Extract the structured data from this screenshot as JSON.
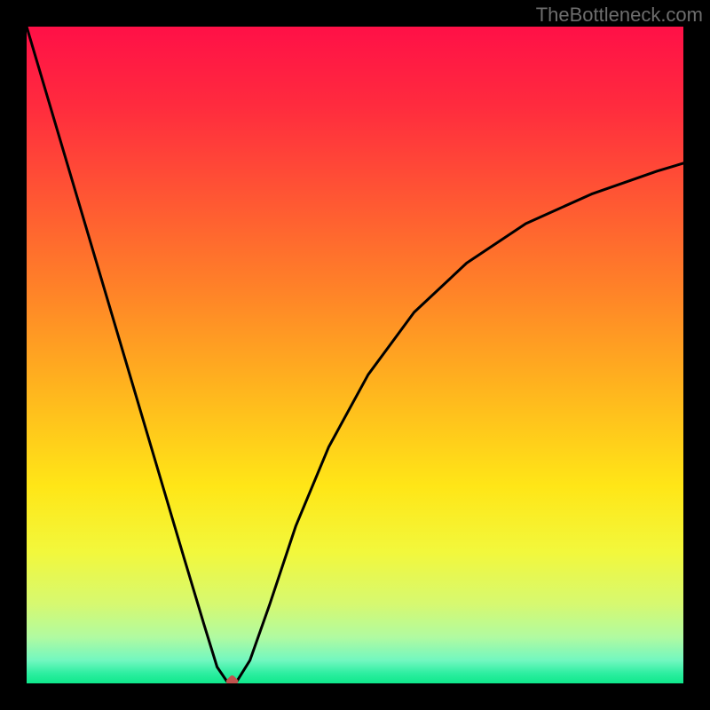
{
  "watermark": "TheBottleneck.com",
  "colors": {
    "black": "#000000",
    "curve": "#000000",
    "marker": "#c1534e",
    "gradient_stops": [
      {
        "offset": 0.0,
        "color": "#ff1047"
      },
      {
        "offset": 0.12,
        "color": "#ff2b3e"
      },
      {
        "offset": 0.25,
        "color": "#ff5334"
      },
      {
        "offset": 0.4,
        "color": "#ff8228"
      },
      {
        "offset": 0.55,
        "color": "#ffb41e"
      },
      {
        "offset": 0.7,
        "color": "#ffe617"
      },
      {
        "offset": 0.8,
        "color": "#f2f83c"
      },
      {
        "offset": 0.88,
        "color": "#d6f971"
      },
      {
        "offset": 0.93,
        "color": "#b0faa1"
      },
      {
        "offset": 0.965,
        "color": "#72f7c0"
      },
      {
        "offset": 0.985,
        "color": "#2ceea0"
      },
      {
        "offset": 1.0,
        "color": "#0fe88b"
      }
    ]
  },
  "chart_data": {
    "type": "line",
    "title": "",
    "xlabel": "",
    "ylabel": "",
    "xlim": [
      0,
      100
    ],
    "ylim": [
      0,
      100
    ],
    "grid": false,
    "legend": false,
    "series": [
      {
        "name": "bottleneck-curve",
        "x": [
          0,
          4,
          8,
          12,
          16,
          20,
          24,
          27,
          29,
          30.5,
          32,
          34,
          37,
          41,
          46,
          52,
          59,
          67,
          76,
          86,
          96,
          100
        ],
        "y": [
          100,
          86.5,
          73,
          59.5,
          46,
          32.5,
          19,
          9,
          2.5,
          0.3,
          0.3,
          3.5,
          12,
          24,
          36,
          47,
          56.5,
          64,
          70,
          74.5,
          78,
          79.2
        ]
      }
    ],
    "annotations": [
      {
        "name": "optimal-point",
        "x": 31.3,
        "y": 0.3,
        "shape": "diamond"
      }
    ]
  }
}
